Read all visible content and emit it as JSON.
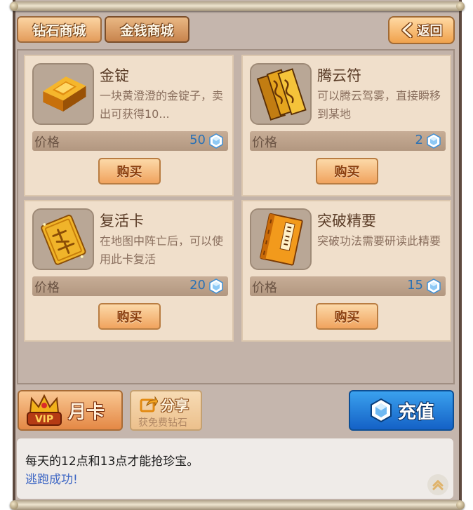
{
  "tabs": [
    {
      "label": "钻石商城"
    },
    {
      "label": "金钱商城"
    }
  ],
  "back_button": {
    "label": "返回",
    "icon": "chevron-left-icon"
  },
  "items": [
    {
      "name": "金锭",
      "desc": "一块黄澄澄的金锭子，卖出可获得10...",
      "price_label": "价格",
      "price": "50",
      "buy_label": "购买",
      "icon": "gold-ingot-icon"
    },
    {
      "name": "腾云符",
      "desc": "可以腾云驾雾，直接瞬移到某地",
      "price_label": "价格",
      "price": "2",
      "buy_label": "购买",
      "icon": "talisman-icon"
    },
    {
      "name": "复活卡",
      "desc": "在地图中阵亡后，可以使用此卡复活",
      "price_label": "价格",
      "price": "20",
      "buy_label": "购买",
      "icon": "revive-card-icon"
    },
    {
      "name": "突破精要",
      "desc": "突破功法需要研读此精要",
      "price_label": "价格",
      "price": "15",
      "buy_label": "购买",
      "icon": "book-icon"
    }
  ],
  "bottom": {
    "month_card_label": "月卡",
    "share_label": "分享",
    "share_sub": "获免费钻石",
    "recharge_label": "充值"
  },
  "messages": [
    "每天的12点和13点才能抢珍宝。",
    "逃跑成功!"
  ],
  "colors": {
    "price_blue": "#2a71b5",
    "link_blue": "#3d66c4",
    "recharge_blue": "#1461c6",
    "card_bg": "#f0dfcb"
  }
}
